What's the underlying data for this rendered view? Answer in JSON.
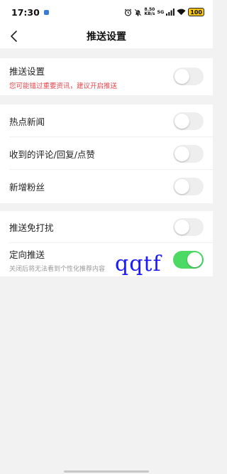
{
  "status_bar": {
    "time": "17:30",
    "net_speed_value": "8.50",
    "net_speed_unit": "KB/s",
    "network": "5G",
    "battery": "100"
  },
  "nav": {
    "title": "推送设置"
  },
  "push": {
    "title": "推送设置",
    "subtitle": "您可能错过重要资讯，建议开启推送",
    "enabled": false
  },
  "notifications": [
    {
      "title": "热点新闻",
      "enabled": false
    },
    {
      "title": "收到的评论/回复/点赞",
      "enabled": false
    },
    {
      "title": "新增粉丝",
      "enabled": false
    }
  ],
  "dnd": {
    "title": "推送免打扰",
    "enabled": false
  },
  "targeted": {
    "title": "定向推送",
    "subtitle": "关闭后将无法看到个性化推荐内容",
    "enabled": true
  },
  "watermark": "qqtf",
  "colors": {
    "toggle_on": "#4cd964",
    "toggle_off": "#eeeeee",
    "warning_text": "#e8454c",
    "watermark": "#1a1aff"
  }
}
